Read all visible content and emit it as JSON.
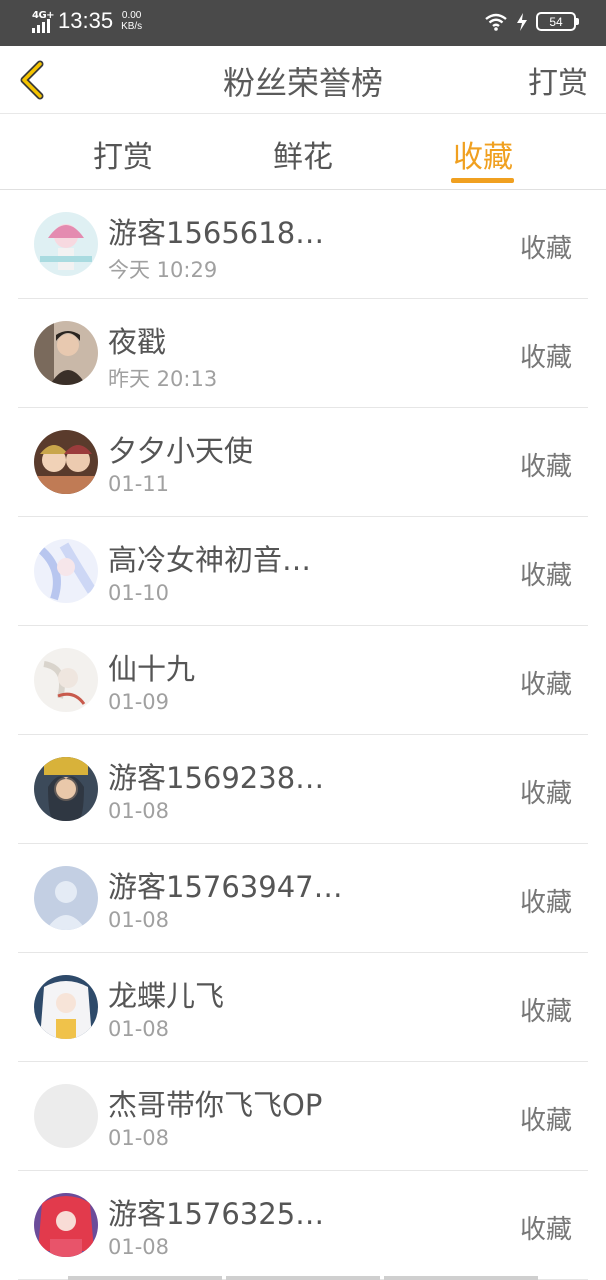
{
  "status_bar": {
    "network": "4G+",
    "time": "13:35",
    "speed_value": "0.00",
    "speed_unit": "KB/s",
    "battery": "54"
  },
  "header": {
    "title": "粉丝荣誉榜",
    "right_action": "打赏",
    "back_icon": "chevron-left-icon"
  },
  "tabs": [
    {
      "label": "打赏",
      "active": false
    },
    {
      "label": "鲜花",
      "active": false
    },
    {
      "label": "收藏",
      "active": true
    }
  ],
  "colors": {
    "accent": "#f0a020",
    "status_bar": "#4a4a4a"
  },
  "list": [
    {
      "name": "游客1565618…",
      "time": "今天 10:29",
      "action": "收藏",
      "avatar": "avatar-pink-anime"
    },
    {
      "name": "夜戳",
      "time": "昨天 20:13",
      "action": "收藏",
      "avatar": "avatar-man-photo"
    },
    {
      "name": "夕夕小天使",
      "time": "01-11",
      "action": "收藏",
      "avatar": "avatar-anime-group"
    },
    {
      "name": "高冷女神初音…",
      "time": "01-10",
      "action": "收藏",
      "avatar": "avatar-blue-anime"
    },
    {
      "name": "仙十九",
      "time": "01-09",
      "action": "收藏",
      "avatar": "avatar-white-sketch"
    },
    {
      "name": "游客1569238…",
      "time": "01-08",
      "action": "收藏",
      "avatar": "avatar-gold-anime"
    },
    {
      "name": "游客15763947…",
      "time": "01-08",
      "action": "收藏",
      "avatar": "avatar-default-person"
    },
    {
      "name": "龙蝶儿飞",
      "time": "01-08",
      "action": "收藏",
      "avatar": "avatar-white-hair-anime"
    },
    {
      "name": "杰哥带你飞飞OP",
      "time": "01-08",
      "action": "收藏",
      "avatar": "avatar-empty"
    },
    {
      "name": "游客1576325…",
      "time": "01-08",
      "action": "收藏",
      "avatar": "avatar-red-anime"
    }
  ]
}
